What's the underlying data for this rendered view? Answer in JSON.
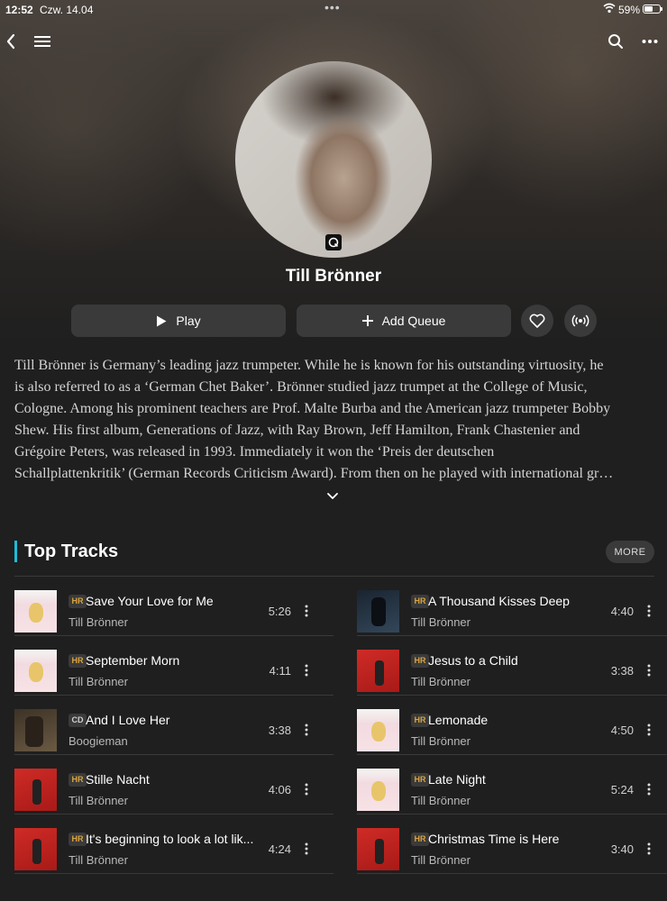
{
  "status_bar": {
    "time": "12:52",
    "date": "Czw. 14.04",
    "battery": "59%",
    "battery_level": 0.59
  },
  "nav": {
    "back_icon": "chevron-left-icon",
    "menu_icon": "hamburger-icon",
    "search_icon": "search-icon",
    "more_icon": "more-horizontal-icon"
  },
  "artist": {
    "name": "Till Brönner"
  },
  "actions": {
    "play_label": "Play",
    "add_queue_label": "Add Queue"
  },
  "bio": {
    "lines": [
      "Till Brönner is Germany’s leading jazz trumpeter. While he is known for his outstanding virtuosity, he",
      "is also referred to as a ‘German Chet Baker’. Brönner studied jazz trumpet at the College of Music,",
      "Cologne. Among his prominent teachers are Prof. Malte Burba and the American jazz trumpeter Bobby",
      "Shew. His first album, Generations of Jazz, with Ray Brown, Jeff Hamilton, Frank Chastenier and",
      "Grégoire Peters, was released in 1993. Immediately it won the ‘Preis der deutschen",
      "Schallplattenkritik’ (German Records Criticism Award). From then on he played with international gr…"
    ]
  },
  "top_tracks": {
    "title": "Top Tracks",
    "more_label": "MORE",
    "accent": "#1ebbd7",
    "left": [
      {
        "title": "Save Your Love for Me",
        "artist": "Till Brönner",
        "duration": "5:26",
        "badge": "HR",
        "cover": "pink"
      },
      {
        "title": "September Morn",
        "artist": "Till Brönner",
        "duration": "4:11",
        "badge": "HR",
        "cover": "pink"
      },
      {
        "title": "And I Love Her",
        "artist": "Boogieman",
        "duration": "3:38",
        "badge": "CD",
        "cover": "brown"
      },
      {
        "title": "Stille Nacht",
        "artist": "Till Brönner",
        "duration": "4:06",
        "badge": "HR",
        "cover": "red"
      },
      {
        "title": "It's beginning to look a lot lik...",
        "artist": "Till Brönner",
        "duration": "4:24",
        "badge": "HR",
        "cover": "red"
      }
    ],
    "right": [
      {
        "title": "A Thousand Kisses Deep",
        "artist": "Till Brönner",
        "duration": "4:40",
        "badge": "HR",
        "cover": "dark"
      },
      {
        "title": "Jesus to a Child",
        "artist": "Till Brönner",
        "duration": "3:38",
        "badge": "HR",
        "cover": "red"
      },
      {
        "title": "Lemonade",
        "artist": "Till Brönner",
        "duration": "4:50",
        "badge": "HR",
        "cover": "pink"
      },
      {
        "title": "Late Night",
        "artist": "Till Brönner",
        "duration": "5:24",
        "badge": "HR",
        "cover": "pink"
      },
      {
        "title": "Christmas Time is Here",
        "artist": "Till Brönner",
        "duration": "3:40",
        "badge": "HR",
        "cover": "red"
      }
    ]
  }
}
